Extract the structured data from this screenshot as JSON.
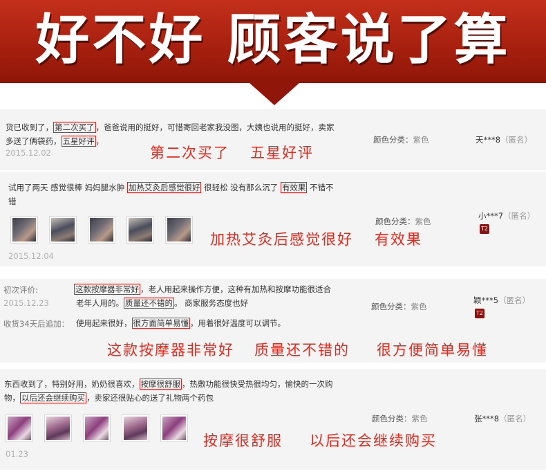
{
  "banner": {
    "title": "好不好 顾客说了算"
  },
  "reviews": [
    {
      "text": [
        "货已收到了，",
        "第二次买了",
        "，爸爸说用的挺好，可惜寄回老家我没图，大姨也说用的挺好，卖家",
        "多送了俩袋药，",
        "五星好评",
        "，"
      ],
      "date": "2015.12.02",
      "color_label": "颜色分类：",
      "color_value": "紫色",
      "user": "天***8",
      "anon": "（匿名）",
      "highlights": [
        "第二次买了",
        "五星好评"
      ]
    },
    {
      "text": [
        "试用了两天 感觉很棒 妈妈腿水肿 ",
        "加热艾灸后感觉很好",
        " 很轻松 没有那么沉了 ",
        "有效果",
        " 不错不",
        "错"
      ],
      "date": "2015.12.04",
      "color_label": "颜色分类：",
      "color_value": "紫色",
      "user": "小***7",
      "anon": "（匿名）",
      "badge": "T2",
      "highlights": [
        "加热艾灸后感觉很好",
        "有效果"
      ]
    },
    {
      "first_label": "初次评价:",
      "date": "2015.12.23",
      "text": [
        "这款按摩器非常好",
        "，老人用起来操作方便，这种有加热和按摩功能很适合",
        "老年人用的。",
        "质量还不错的",
        "。 商家服务态度也好"
      ],
      "followup_label": "收货34天后追加：",
      "followup": [
        "使用起来很好，",
        "很方面简单易懂",
        "，用着很好温度可以调节。"
      ],
      "color_label": "颜色分类：",
      "color_value": "紫色",
      "user": "颖***5",
      "anon": "（匿名）",
      "badge": "T2",
      "highlights": [
        "这款按摩器非常好",
        "质量还不错的",
        "很方便简单易懂"
      ]
    },
    {
      "text": [
        "东西收到了，特别好用，奶奶很喜欢，",
        "按摩很舒服",
        "，热敷功能很快受热很均匀，愉快的一次购",
        "物，",
        "以后还会继续购买",
        "，卖家还很贴心的送了礼物两个药包"
      ],
      "date": "01.23",
      "color_label": "颜色分类：",
      "color_value": "紫色",
      "user": "张***8",
      "anon": "（匿名）",
      "highlights": [
        "按摩很舒服",
        "以后还会继续购买"
      ]
    }
  ]
}
